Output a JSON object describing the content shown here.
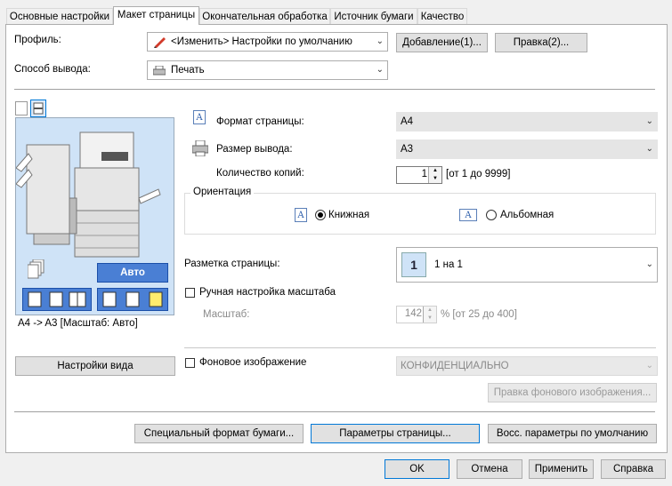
{
  "tabs": [
    {
      "label": "Основные настройки"
    },
    {
      "label": "Макет страницы"
    },
    {
      "label": "Окончательная обработка"
    },
    {
      "label": "Источник бумаги"
    },
    {
      "label": "Качество"
    }
  ],
  "profile": {
    "label": "Профиль:",
    "value": "<Изменить> Настройки по умолчанию",
    "add_button": "Добавление(1)...",
    "edit_button": "Правка(2)..."
  },
  "output": {
    "label": "Способ вывода:",
    "value": "Печать"
  },
  "preview": {
    "auto_label": "Авто",
    "caption": "A4 -> A3 [Масштаб: Авто]",
    "view_settings_button": "Настройки вида"
  },
  "page_size": {
    "label": "Формат страницы:",
    "value": "A4"
  },
  "output_size": {
    "label": "Размер вывода:",
    "value": "A3"
  },
  "copies": {
    "label": "Количество копий:",
    "value": "1",
    "range": "[от 1 до 9999]"
  },
  "orientation": {
    "group_label": "Ориентация",
    "portrait": "Книжная",
    "landscape": "Альбомная",
    "icon_letter": "A"
  },
  "layout": {
    "label": "Разметка страницы:",
    "value": "1 на 1",
    "icon_number": "1"
  },
  "manual_scale": {
    "checkbox_label": "Ручная настройка масштаба",
    "scale_label": "Масштаб:",
    "scale_value": "142",
    "scale_range": "% [от 25 до 400]"
  },
  "watermark": {
    "checkbox_label": "Фоновое изображение",
    "value": "КОНФИДЕНЦИАЛЬНО",
    "edit_button": "Правка фонового изображения..."
  },
  "bottom_buttons": {
    "custom_paper": "Специальный формат бумаги...",
    "page_options": "Параметры страницы...",
    "restore_defaults": "Восс. параметры по умолчанию"
  },
  "dialog_buttons": {
    "ok": "OK",
    "cancel": "Отмена",
    "apply": "Применить",
    "help": "Справка"
  },
  "colors": {
    "accent": "#0078d7",
    "preview_bg": "#cfe3f7",
    "auto_button": "#4a7fd4"
  }
}
